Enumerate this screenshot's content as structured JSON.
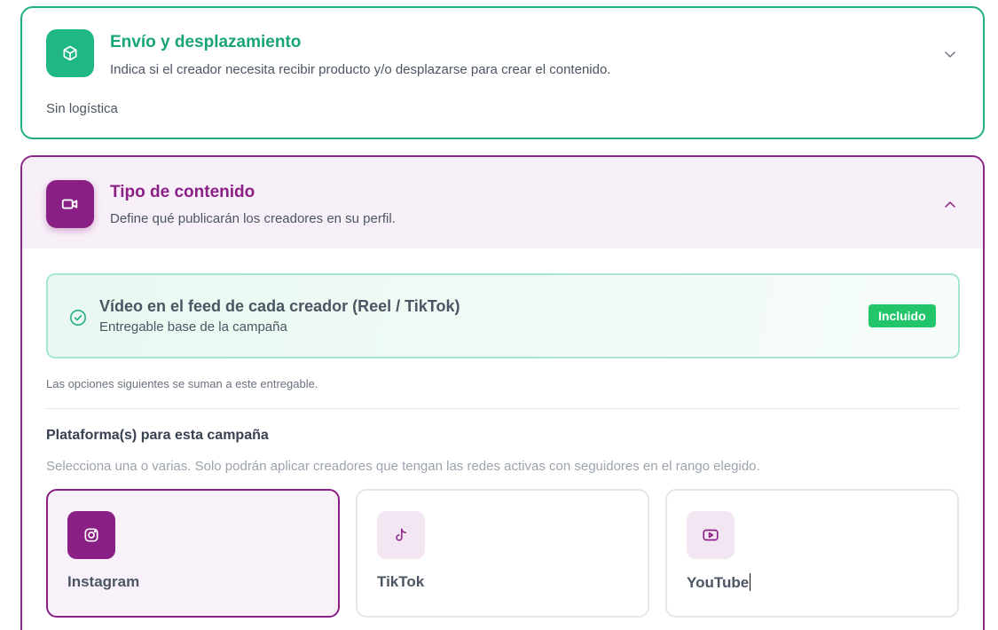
{
  "shipping": {
    "title": "Envío y desplazamiento",
    "description": "Indica si el creador necesita recibir producto y/o desplazarse para crear el contenido.",
    "value": "Sin logística",
    "icon": "box-icon",
    "accent": "#1fb882",
    "expanded": false
  },
  "content_type": {
    "title": "Tipo de contenido",
    "description": "Define qué publicarán los creadores en su perfil.",
    "icon": "video-camera-icon",
    "accent": "#8a1f85",
    "expanded": true,
    "included": {
      "title": "Vídeo en el feed de cada creador (Reel / TikTok)",
      "subtitle": "Entregable base de la campaña",
      "badge": "Incluido",
      "badge_color": "#22c56a"
    },
    "note": "Las opciones siguientes se suman a este entregable.",
    "platforms_label": "Plataforma(s) para esta campaña",
    "platforms_help": "Selecciona una o varias. Solo podrán aplicar creadores que tengan las redes activas con seguidores en el rango elegido.",
    "platforms": [
      {
        "label": "Instagram",
        "icon": "instagram-icon",
        "selected": true
      },
      {
        "label": "TikTok",
        "icon": "tiktok-icon",
        "selected": false
      },
      {
        "label": "YouTube",
        "icon": "youtube-icon",
        "selected": false
      }
    ]
  }
}
